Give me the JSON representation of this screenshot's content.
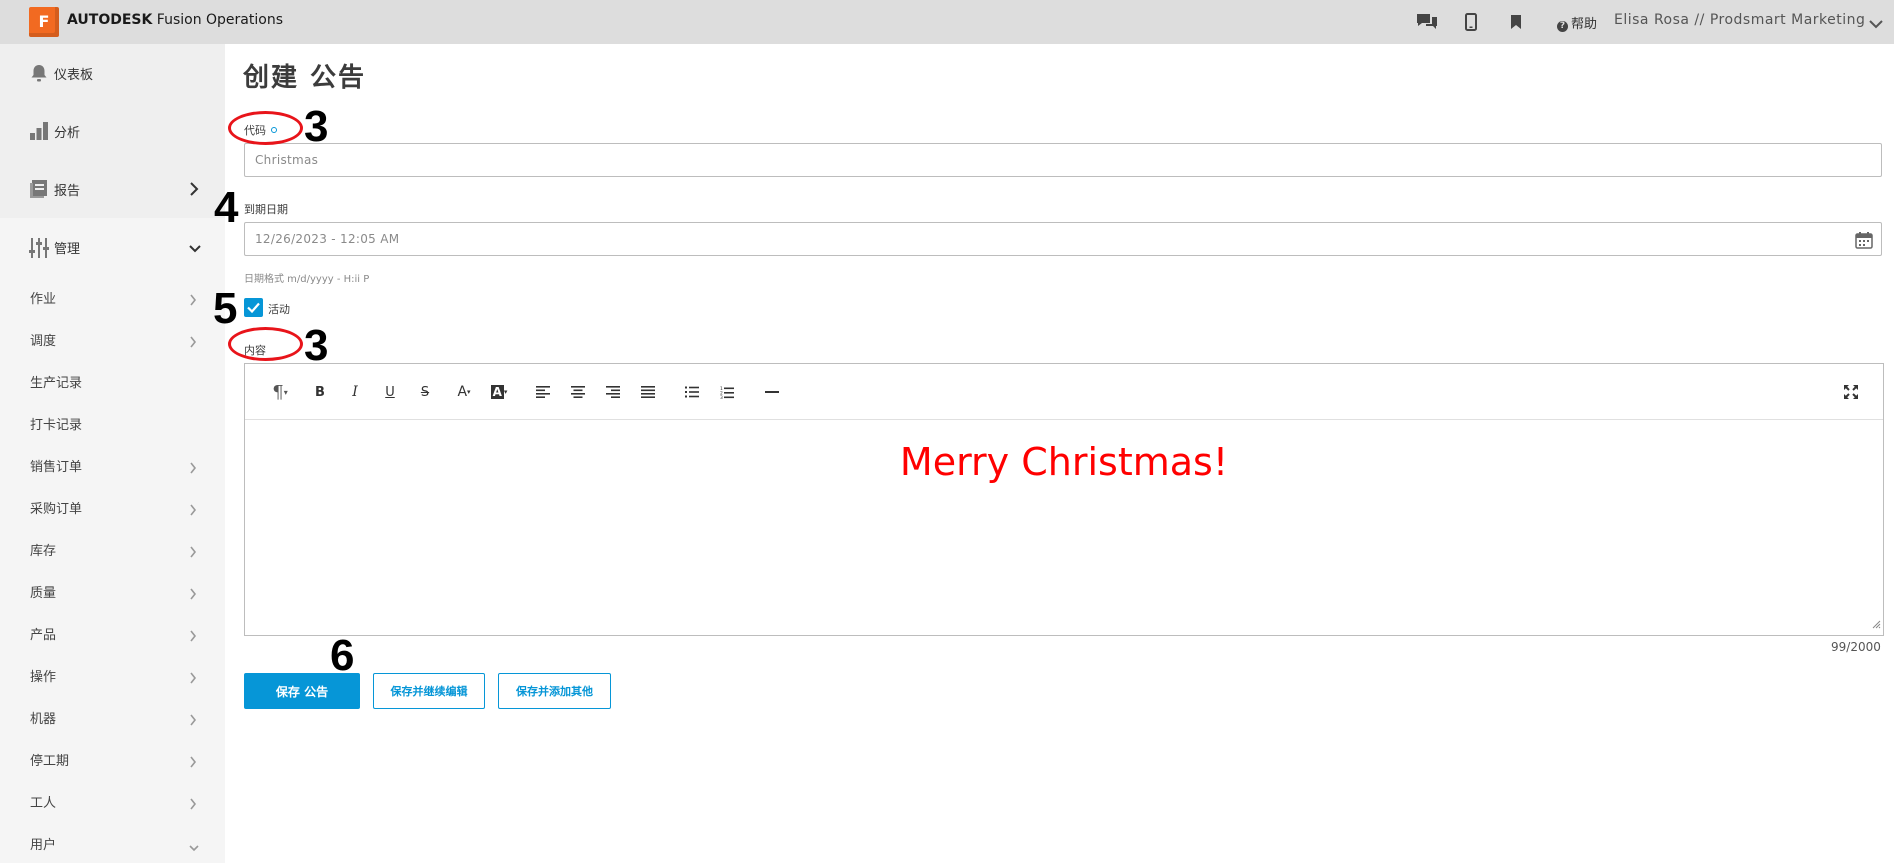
{
  "app": {
    "logo_letter": "F",
    "brand_bold": "AUTODESK",
    "brand_rest": " Fusion Operations",
    "help_label": "帮助",
    "user": "Elisa Rosa // Prodsmart Marketing",
    "accent_color": "#0696d7",
    "logo_color": "#f26a21"
  },
  "topbar_icons": [
    "chat-icon",
    "mobile-icon",
    "bookmark-icon",
    "help-icon",
    "chevron-down-icon"
  ],
  "sidebar": {
    "main": [
      {
        "label": "仪表板",
        "icon": "bell-icon"
      },
      {
        "label": "分析",
        "icon": "bar-chart-icon"
      },
      {
        "label": "报告",
        "icon": "report-icon",
        "chevron": "right"
      },
      {
        "label": "管理",
        "icon": "sliders-icon",
        "chevron": "down"
      }
    ],
    "sub": [
      {
        "label": "作业",
        "chevron": true
      },
      {
        "label": "调度",
        "chevron": true
      },
      {
        "label": "生产记录",
        "chevron": false
      },
      {
        "label": "打卡记录",
        "chevron": false
      },
      {
        "label": "销售订单",
        "chevron": true
      },
      {
        "label": "采购订单",
        "chevron": true
      },
      {
        "label": "库存",
        "chevron": true
      },
      {
        "label": "质量",
        "chevron": true
      },
      {
        "label": "产品",
        "chevron": true
      },
      {
        "label": "操作",
        "chevron": true
      },
      {
        "label": "机器",
        "chevron": true
      },
      {
        "label": "停工期",
        "chevron": true
      },
      {
        "label": "工人",
        "chevron": true
      },
      {
        "label": "用户",
        "chevron": "down"
      }
    ]
  },
  "form": {
    "title": "创建 公告",
    "code_label": "代码",
    "code_value": "Christmas",
    "due_label": "到期日期",
    "due_value": "12/26/2023 - 12:05 AM",
    "date_hint": "日期格式 m/d/yyyy - H:ii P",
    "active_label": "活动",
    "active_checked": true,
    "content_label": "内容",
    "content_text": "Merry Christmas!",
    "content_color": "#ff0000",
    "counter": "99/2000",
    "save_button": "保存 公告",
    "save_continue_button": "保存并继续编辑",
    "save_add_button": "保存并添加其他"
  },
  "toolbar": {
    "paragraph": "¶",
    "bold": "B",
    "italic": "I",
    "underline": "U",
    "strike": "S",
    "font_color": "A",
    "bg_color": "A"
  },
  "annotations": [
    "3",
    "4",
    "5",
    "3",
    "6"
  ]
}
